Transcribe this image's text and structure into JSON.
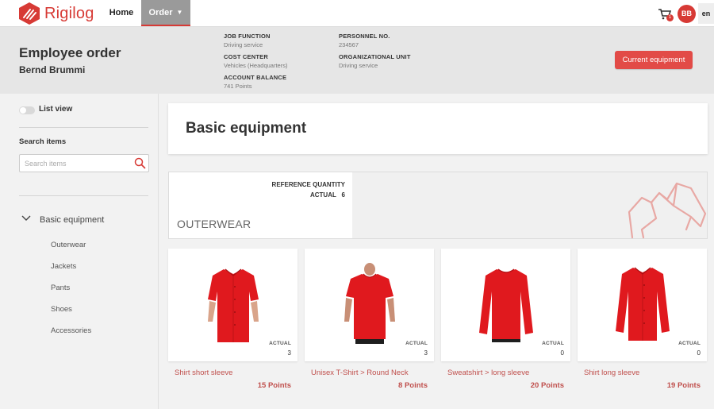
{
  "brand": {
    "name": "Rigilog",
    "color": "#d73a35"
  },
  "nav": {
    "home": "Home",
    "order": "Order"
  },
  "cart": {
    "count": "1"
  },
  "user": {
    "initials": "BB",
    "language": "en"
  },
  "header": {
    "title": "Employee order",
    "name": "Bernd Brummi",
    "fields": [
      {
        "label": "JOB FUNCTION",
        "value": "Driving service"
      },
      {
        "label": "COST CENTER",
        "value": "Vehicles (Headquarters)"
      },
      {
        "label": "ACCOUNT BALANCE",
        "value": "741 Points"
      },
      {
        "label": "PERSONNEL NO.",
        "value": "234567"
      },
      {
        "label": "ORGANIZATIONAL UNIT",
        "value": "Driving service"
      }
    ],
    "current_equipment_button": "Current equipment"
  },
  "sidebar": {
    "list_view_label": "List view",
    "list_view_on": false,
    "search_label": "Search items",
    "search_placeholder": "Search items",
    "search_value": "",
    "tree": {
      "root": "Basic equipment",
      "items": [
        "Outerwear",
        "Jackets",
        "Pants",
        "Shoes",
        "Accessories"
      ]
    }
  },
  "main": {
    "title": "Basic equipment",
    "category": {
      "name": "OUTERWEAR",
      "reference_label": "REFERENCE QUANTITY",
      "actual_label": "ACTUAL",
      "actual_value": "6"
    },
    "products": [
      {
        "name": "Shirt short sleeve",
        "points": "15 Points",
        "actual_label": "ACTUAL",
        "actual": "3",
        "icon": "short-sleeve-shirt-icon"
      },
      {
        "name": "Unisex T-Shirt > Round Neck",
        "points": "8 Points",
        "actual_label": "ACTUAL",
        "actual": "3",
        "icon": "t-shirt-icon"
      },
      {
        "name": "Sweatshirt > long sleeve",
        "points": "20 Points",
        "actual_label": "ACTUAL",
        "actual": "0",
        "icon": "sweatshirt-icon"
      },
      {
        "name": "Shirt long sleeve",
        "points": "19 Points",
        "actual_label": "ACTUAL",
        "actual": "0",
        "icon": "long-sleeve-shirt-icon"
      }
    ]
  },
  "colors": {
    "accent": "#d73a35",
    "button": "#e24b47",
    "link": "#c0504d",
    "garment": "#e0191e"
  }
}
